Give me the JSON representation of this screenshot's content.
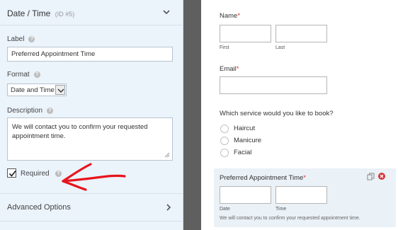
{
  "field_options": {
    "title": "Date / Time",
    "field_id": "(ID #5)",
    "label": {
      "caption": "Label",
      "value": "Preferred Appointment Time"
    },
    "format": {
      "caption": "Format",
      "selected": "Date and Time"
    },
    "description": {
      "caption": "Description",
      "value": "We will contact you to confirm your requested appointment time."
    },
    "required": {
      "caption": "Required",
      "checked": true
    },
    "advanced_options_label": "Advanced Options",
    "help_glyph": "?"
  },
  "preview_form": {
    "name": {
      "label": "Name",
      "required_mark": "*",
      "first_sub": "First",
      "last_sub": "Last"
    },
    "email": {
      "label": "Email",
      "required_mark": "*"
    },
    "service": {
      "question": "Which service would you like to book?",
      "options": [
        "Haircut",
        "Manicure",
        "Facial"
      ]
    },
    "appointment": {
      "label": "Preferred Appointment Time",
      "required_mark": "*",
      "date_sub": "Date",
      "time_sub": "Time",
      "description": "We will contact you to confirm your requested appointment time."
    }
  },
  "colors": {
    "panel_bg": "#ebf3fb",
    "required_red": "#d63638",
    "annotation_arrow": "#e8141c",
    "gap": "#5f5f5f",
    "selected_field_bg": "#eaf1f7"
  },
  "icons": [
    "chevron-down-icon",
    "help-icon",
    "checkmark-icon",
    "chevron-right-icon",
    "duplicate-icon",
    "delete-icon",
    "resize-grip-icon",
    "red-arrow-annotation"
  ]
}
